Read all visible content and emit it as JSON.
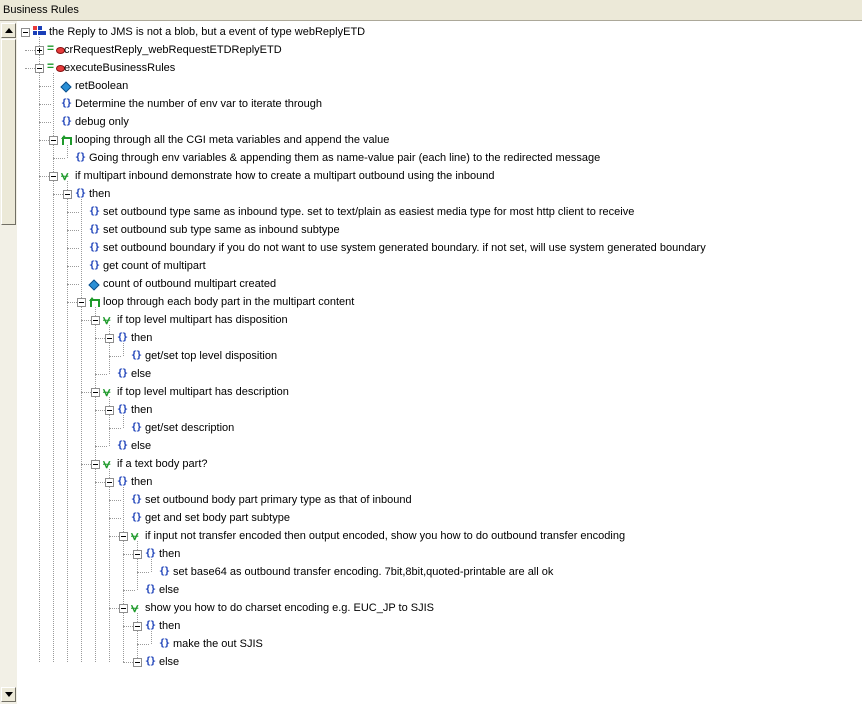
{
  "panel": {
    "title": "Business Rules"
  },
  "tree": [
    {
      "depth": 0,
      "expander": "minus",
      "icon": "collaboration-icon",
      "text": "the Reply to JMS is not a blob, but a event of type webReplyETD"
    },
    {
      "depth": 1,
      "expander": "plus",
      "icon": "method-icon",
      "text": "crRequestReply_webRequestETDReplyETD"
    },
    {
      "depth": 1,
      "expander": "minus",
      "icon": "method-icon",
      "text": "executeBusinessRules"
    },
    {
      "depth": 2,
      "expander": "none",
      "icon": "variable-icon",
      "text": "retBoolean"
    },
    {
      "depth": 2,
      "expander": "none",
      "icon": "rule-icon",
      "text": "Determine the number of env var to iterate through"
    },
    {
      "depth": 2,
      "expander": "none",
      "icon": "rule-icon",
      "text": "debug only"
    },
    {
      "depth": 2,
      "expander": "minus",
      "icon": "loop-icon",
      "text": "looping through all the CGI meta variables and append the value"
    },
    {
      "depth": 3,
      "expander": "none",
      "icon": "rule-icon",
      "text": "Going through env variables & appending them as name-value pair (each line) to the redirected message"
    },
    {
      "depth": 2,
      "expander": "minus",
      "icon": "branch-icon",
      "text": "if multipart inbound demonstrate how to create a multipart outbound using the inbound"
    },
    {
      "depth": 3,
      "expander": "minus",
      "icon": "rule-icon",
      "text": "then"
    },
    {
      "depth": 4,
      "expander": "none",
      "icon": "rule-icon",
      "text": "set outbound type same as inbound  type. set to text/plain as easiest media type for most http client to receive"
    },
    {
      "depth": 4,
      "expander": "none",
      "icon": "rule-icon",
      "text": "set outbound sub type same as inbound subtype"
    },
    {
      "depth": 4,
      "expander": "none",
      "icon": "rule-icon",
      "text": "set outbound boundary if you do not want to use system generated boundary. if not set, will use system generated boundary"
    },
    {
      "depth": 4,
      "expander": "none",
      "icon": "rule-icon",
      "text": "get count of multipart"
    },
    {
      "depth": 4,
      "expander": "none",
      "icon": "variable-icon",
      "text": "count of outbound multipart created"
    },
    {
      "depth": 4,
      "expander": "minus",
      "icon": "loop-icon",
      "text": "loop through each body part in the multipart content"
    },
    {
      "depth": 5,
      "expander": "minus",
      "icon": "branch-icon",
      "text": "if top level multipart has disposition"
    },
    {
      "depth": 6,
      "expander": "minus",
      "icon": "rule-icon",
      "text": "then"
    },
    {
      "depth": 7,
      "expander": "none",
      "icon": "rule-icon",
      "text": "get/set top level  disposition"
    },
    {
      "depth": 6,
      "expander": "none",
      "icon": "rule-icon",
      "text": "else"
    },
    {
      "depth": 5,
      "expander": "minus",
      "icon": "branch-icon",
      "text": "if top level multipart has description"
    },
    {
      "depth": 6,
      "expander": "minus",
      "icon": "rule-icon",
      "text": "then"
    },
    {
      "depth": 7,
      "expander": "none",
      "icon": "rule-icon",
      "text": "get/set description"
    },
    {
      "depth": 6,
      "expander": "none",
      "icon": "rule-icon",
      "text": "else"
    },
    {
      "depth": 5,
      "expander": "minus",
      "icon": "branch-icon",
      "text": "if a text body part?"
    },
    {
      "depth": 6,
      "expander": "minus",
      "icon": "rule-icon",
      "text": "then"
    },
    {
      "depth": 7,
      "expander": "none",
      "icon": "rule-icon",
      "text": "set outbound body part primary type as that of inbound"
    },
    {
      "depth": 7,
      "expander": "none",
      "icon": "rule-icon",
      "text": "get and set body part subtype"
    },
    {
      "depth": 7,
      "expander": "minus",
      "icon": "branch-icon",
      "text": "if input not transfer encoded then output encoded, show you how to do outbound transfer encoding"
    },
    {
      "depth": 8,
      "expander": "minus",
      "icon": "rule-icon",
      "text": "then"
    },
    {
      "depth": 9,
      "expander": "none",
      "icon": "rule-icon",
      "text": "set base64 as outbound transfer encoding. 7bit,8bit,quoted-printable are all ok"
    },
    {
      "depth": 8,
      "expander": "none",
      "icon": "rule-icon",
      "text": "else"
    },
    {
      "depth": 7,
      "expander": "minus",
      "icon": "branch-icon",
      "text": "show you how to do charset encoding e.g. EUC_JP to SJIS"
    },
    {
      "depth": 8,
      "expander": "minus",
      "icon": "rule-icon",
      "text": "then"
    },
    {
      "depth": 9,
      "expander": "none",
      "icon": "rule-icon",
      "text": "make the out SJIS"
    },
    {
      "depth": 8,
      "expander": "minus",
      "icon": "rule-icon",
      "text": "else"
    }
  ]
}
